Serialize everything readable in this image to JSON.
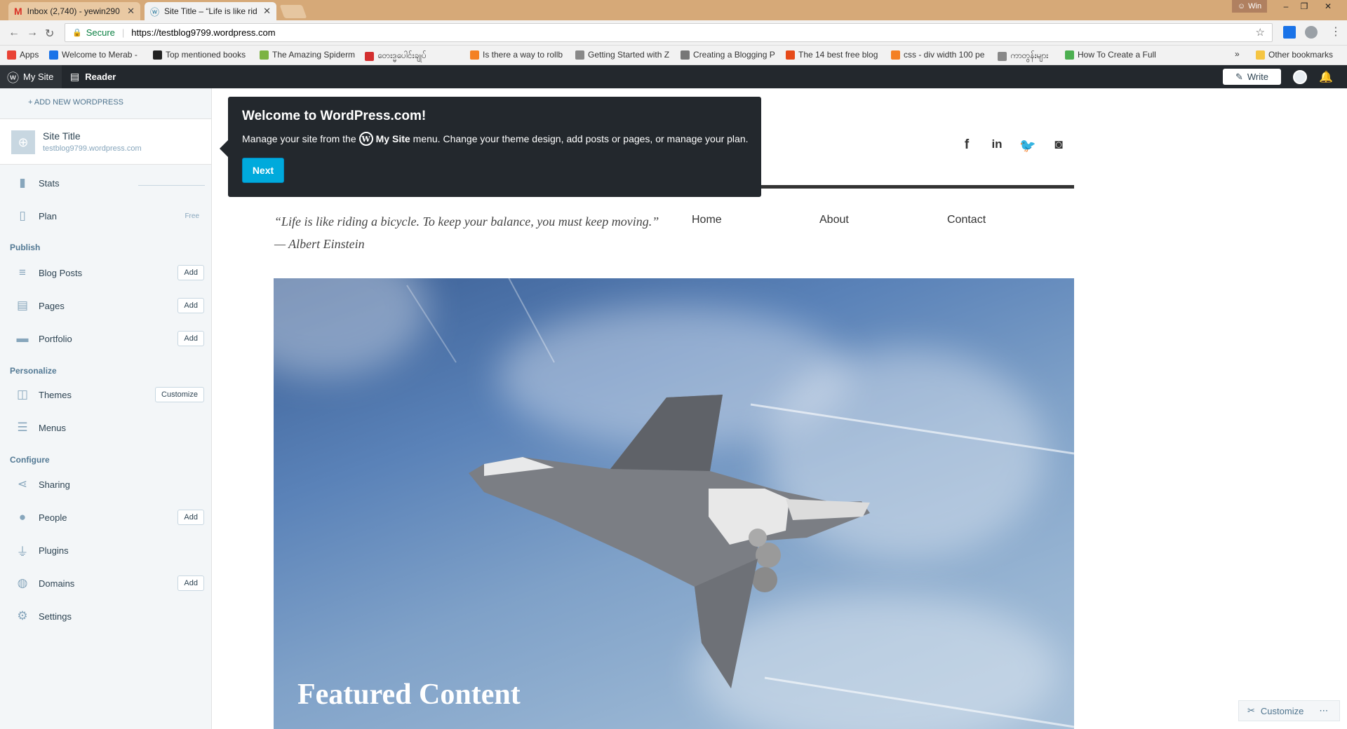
{
  "browser": {
    "tabs": [
      {
        "title": "Inbox (2,740) - yewin290",
        "icon": "gmail-icon"
      },
      {
        "title": "Site Title – “Life is like rid",
        "icon": "wordpress-icon"
      }
    ],
    "user_badge": "Win",
    "url_secure": "Secure",
    "url": "https://testblog9799.wordpress.com",
    "bookmarks": [
      {
        "label": "Apps",
        "color": "#e94235"
      },
      {
        "label": "Welcome to Merab -",
        "color": "#1a73e8"
      },
      {
        "label": "Top mentioned books",
        "color": "#222222"
      },
      {
        "label": "The Amazing Spiderm",
        "color": "#7cb342"
      },
      {
        "label": "တေးဒ္မပေါင်းချုပ်",
        "color": "#d32f2f"
      },
      {
        "label": "Is there a way to rollb",
        "color": "#f48024"
      },
      {
        "label": "Getting Started with Z",
        "color": "#888888"
      },
      {
        "label": "Creating a Blogging P",
        "color": "#777777"
      },
      {
        "label": "The 14 best free blog",
        "color": "#e64a19"
      },
      {
        "label": "css - div width 100 pe",
        "color": "#f48024"
      },
      {
        "label": "ကာတွန်းများ",
        "color": "#888888"
      },
      {
        "label": "How To Create a Full",
        "color": "#4caf50"
      }
    ],
    "other_bookmarks": "Other bookmarks"
  },
  "masterbar": {
    "my_site": "My Site",
    "reader": "Reader",
    "write": "Write"
  },
  "sidebar": {
    "add_new": "+ ADD NEW WORDPRESS",
    "site_name": "Site Title",
    "site_url": "testblog9799.wordpress.com",
    "stats": "Stats",
    "plan": "Plan",
    "plan_badge": "Free",
    "publish_header": "Publish",
    "blog_posts": "Blog Posts",
    "pages": "Pages",
    "portfolio": "Portfolio",
    "personalize_header": "Personalize",
    "themes": "Themes",
    "menus": "Menus",
    "configure_header": "Configure",
    "sharing": "Sharing",
    "people": "People",
    "plugins": "Plugins",
    "domains": "Domains",
    "settings": "Settings",
    "add_label": "Add",
    "customize_label": "Customize"
  },
  "tooltip": {
    "heading": "Welcome to WordPress.com!",
    "text_before": "Manage your site from the",
    "my_site": "My Site",
    "text_after": "menu. Change your theme design, add posts or pages, or manage your plan.",
    "next": "Next"
  },
  "site": {
    "quote": "“Life is like riding a bicycle. To keep your balance, you must keep moving.” — Albert Einstein",
    "menu": [
      "Home",
      "About",
      "Contact"
    ],
    "featured": "Featured Content",
    "social": [
      "facebook-icon",
      "linkedin-icon",
      "twitter-icon",
      "instagram-icon"
    ]
  },
  "customize_bar": {
    "label": "Customize"
  }
}
